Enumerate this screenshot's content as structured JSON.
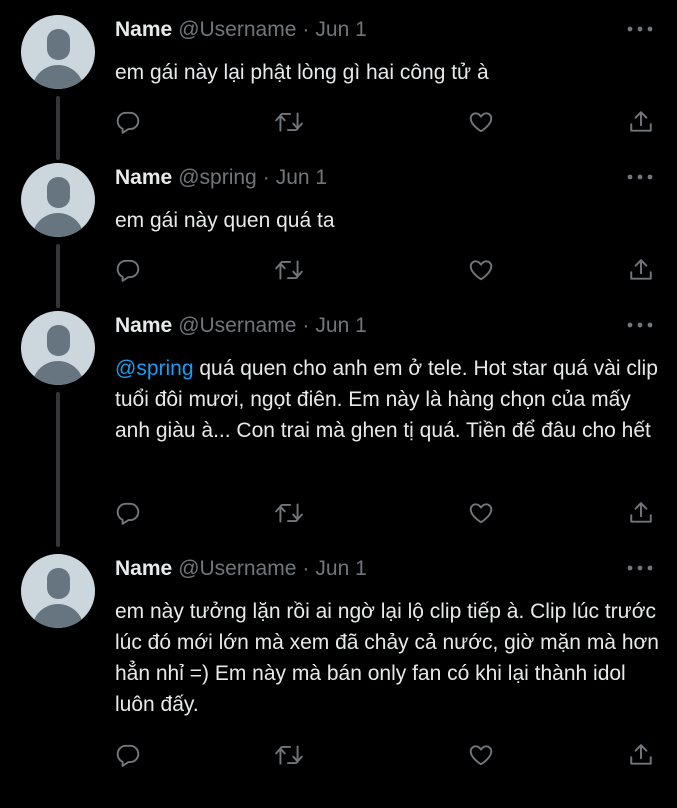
{
  "colors": {
    "background": "#000000",
    "text_primary": "#e7e9ea",
    "text_secondary": "#71767b",
    "mention": "#1d9bf0",
    "thread_line": "#333639",
    "avatar_bg": "#ccd6dd",
    "avatar_fg": "#66757f"
  },
  "icons": {
    "more": "more-horizontal-icon",
    "reply": "reply-icon",
    "retweet": "retweet-icon",
    "like": "like-icon",
    "share": "share-icon"
  },
  "tweets": [
    {
      "name": "Name",
      "handle": "@Username",
      "separator": "·",
      "date": "Jun 1",
      "mention": "",
      "text": "em gái này lại phật lòng gì hai công tử à"
    },
    {
      "name": "Name",
      "handle": "@spring",
      "separator": "·",
      "date": "Jun 1",
      "mention": "",
      "text": "em gái này quen quá ta"
    },
    {
      "name": "Name",
      "handle": "@Username",
      "separator": "·",
      "date": "Jun 1",
      "mention": "@spring",
      "text": " quá quen cho anh em ở tele. Hot star quá vài clip tuổi đôi mươi, ngọt điên. Em này là hàng chọn của mấy anh giàu à... Con trai mà ghen tị quá. Tiền để đâu cho hết"
    },
    {
      "name": "Name",
      "handle": "@Username",
      "separator": "·",
      "date": "Jun 1",
      "mention": "",
      "text": "em này tưởng lặn rồi ai ngờ lại lộ clip tiếp à. Clip lúc trước lúc đó mới lớn mà xem đã chảy cả nước, giờ mặn mà hơn hẳn nhỉ =) Em này mà bán only fan có khi lại thành idol luôn đấy."
    }
  ]
}
